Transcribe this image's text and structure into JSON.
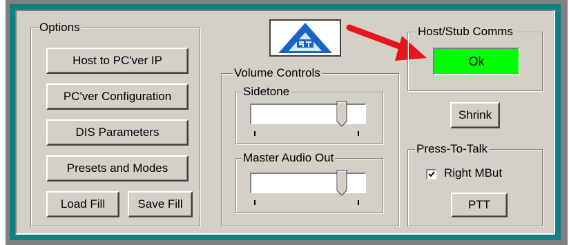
{
  "options": {
    "title": "Options",
    "buttons": {
      "host_to_pcver_ip": "Host to PC'ver IP",
      "pcver_configuration": "PC'ver Configuration",
      "dis_parameters": "DIS Parameters",
      "presets_and_modes": "Presets and Modes",
      "load_fill": "Load Fill",
      "save_fill": "Save Fill"
    }
  },
  "logo": {
    "text": "S.T.",
    "icon": "company-logo-icon"
  },
  "volume": {
    "title": "Volume Controls",
    "sidetone": {
      "title": "Sidetone",
      "level": 0.82
    },
    "master": {
      "title": "Master Audio Out",
      "level": 0.82
    }
  },
  "host_stub": {
    "title": "Host/Stub Comms",
    "status": "Ok",
    "status_color": "#00ff00"
  },
  "shrink_label": "Shrink",
  "ptt": {
    "title": "Press-To-Talk",
    "checkbox_label": "Right MBut",
    "checked": true,
    "button_label": "PTT"
  },
  "annotation": {
    "arrow_color": "#e8141c"
  }
}
